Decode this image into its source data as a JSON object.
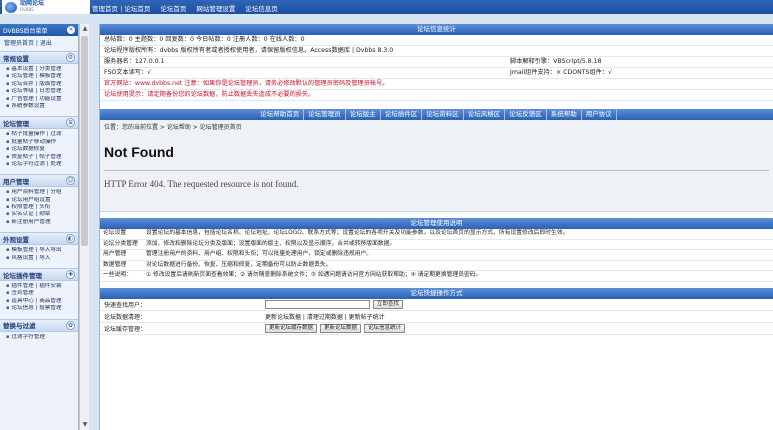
{
  "topbar": {
    "logo_text": "动网论坛",
    "logo_sub": "DVBBS",
    "nav": [
      "管理首页 | 论坛首页",
      "论坛首页",
      "网站管理设置",
      "论坛信息页"
    ]
  },
  "sidebar": {
    "user_title": "DVBBS后台菜单",
    "close_icon": "×",
    "user_links": "管理员首页 | 退出",
    "sections": [
      {
        "title": "常规设置",
        "icon": "⚙",
        "items": [
          "基本设置 | 分类管理",
          "论坛管理 | 模板管理",
          "论坛合并 | 版面管理",
          "论坛等级 | 日志管理",
          "广告管理 | 功能设置",
          "系统参数设置"
        ]
      },
      {
        "title": "论坛管理",
        "icon": "≡",
        "items": [
          "帖子批量操作 | 过滤",
          "批量帖子移动操作",
          "论坛数据修复",
          "恢复帖子 | 帖子管理",
          "论坛字符过滤 | 处理"
        ]
      },
      {
        "title": "用户管理",
        "icon": "☺",
        "items": [
          "用户资料管理 | 分组",
          "论坛用户组设置",
          "权限管理 | 头衔",
          "实名认证 | 勋章",
          "新注册用户管理"
        ]
      },
      {
        "title": "外观设置",
        "icon": "◐",
        "items": [
          "模板管理 | 导入导出",
          "风格设置 | 导入"
        ]
      },
      {
        "title": "论坛插件管理",
        "icon": "✚",
        "items": [
          "插件管理 | 插件安装",
          "签到管理",
          "道具中心 | 商品管理",
          "论坛信息 | 投票管理"
        ]
      },
      {
        "title": "替换与过滤",
        "icon": "✿",
        "items": [
          "过滤字符管理"
        ]
      }
    ]
  },
  "main": {
    "sysinfo_title": "论坛信息统计",
    "rows": [
      {
        "text": "总帖数：0  主题数：0  回复数：0  今日帖数：0  注册人数：0  在线人数：0"
      },
      {
        "text": "论坛程序版权所有：dvbbs  版权所有者或者授权使用者，请保留版权信息。Access数据库 | Dvbbs 8.3.0"
      },
      {
        "text": "服务器名：127.0.0.1",
        "right": "脚本解释引擎：VBScript/5.8.18"
      },
      {
        "text": "FSO文本读写：√",
        "right": "Jmail组件支持：×  CDONTS组件：√"
      },
      {
        "text": "官方网站：www.dvbbs.net  注意：如果你是论坛管理员，请务必修改默认的管理员密码及管理员帐号。",
        "red": true
      },
      {
        "text": "论坛使用提示：请定期备份您的论坛数据，防止数据丢失造成不必要的损失。",
        "red": true
      }
    ],
    "tabs": [
      "论坛帮助首页",
      "论坛管理员",
      "论坛版主",
      "论坛插件区",
      "论坛资料区",
      "论坛风格区",
      "论坛反馈区",
      "系统帮助",
      "用户协议"
    ],
    "crumb": "位置：您的当前位置 > 论坛帮助 > 论坛管理员首页",
    "notfound_title": "Not Found",
    "notfound_msg": "HTTP Error 404. The requested resource is not found.",
    "tech_title": "论坛管理使用说明",
    "tech_rows": [
      {
        "label": "论坛设置",
        "value": "设置论坛的基本信息，包括论坛名称、论坛地址、论坛LOGO、联系方式等；设置论坛的各项开关及功能参数，以及论坛首页的显示方式。所有设置修改后即时生效。"
      },
      {
        "label": "论坛分类管理",
        "value": "添加、修改和删除论坛分类及版面；设置版面的版主、权限以及显示顺序，合并或转移版面数据。"
      },
      {
        "label": "用户管理",
        "value": "管理注册用户的资料、用户组、权限和头衔；可以批量处理用户，锁定或删除违规用户。"
      },
      {
        "label": "数据管理",
        "value": "对论坛数据进行备份、恢复、压缩和修复，定期备份可以防止数据丢失。"
      },
      {
        "label": "一些说明：",
        "value": "① 修改设置后请刷新页面查看效果；② 请勿随意删除系统文件；③ 如遇问题请访问官方网站获取帮助；④ 请定期更换管理员密码。"
      }
    ],
    "quick_title": "论坛快捷操作方式",
    "quick_rows": [
      {
        "label": "快速查找用户：",
        "input": true,
        "buttons": [
          "立即查找"
        ]
      },
      {
        "label": "论坛数据清理：",
        "text": "更新论坛数据 | 清理过期数据 | 更新帖子统计"
      },
      {
        "label": "论坛缓存管理：",
        "buttons": [
          "更新论坛缓存数据",
          "更新论坛数据",
          "论坛信息统计"
        ]
      }
    ]
  }
}
